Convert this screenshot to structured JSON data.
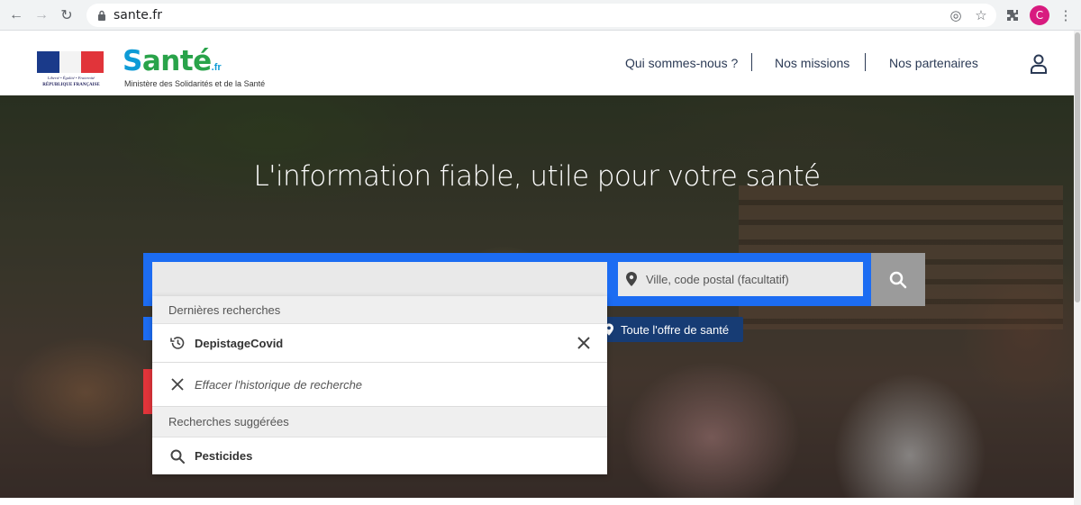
{
  "browser": {
    "url": "sante.fr",
    "profile_initial": "C",
    "icons": [
      "back-arrow-icon",
      "forward-arrow-icon",
      "reload-icon",
      "lock-icon",
      "location-target-icon",
      "star-icon",
      "extensions-icon",
      "menu-dots-icon"
    ]
  },
  "header": {
    "republic_motto": "Liberté • Égalité • Fraternité",
    "republic_name": "RÉPUBLIQUE FRANÇAISE",
    "brand_s": "S",
    "brand_rest": "anté",
    "brand_fr": ".fr",
    "brand_subtitle": "Ministère des Solidarités et de la Santé",
    "nav": [
      "Qui sommes-nous ?",
      "Nos missions",
      "Nos partenaires"
    ]
  },
  "hero": {
    "title": "L'information fiable, utile pour votre santé"
  },
  "search": {
    "query_value": "",
    "location_placeholder": "Ville, code postal (facultatif)"
  },
  "offer_pill": "Toute l'offre de santé",
  "dropdown": {
    "recent_header": "Dernières recherches",
    "recent_items": [
      "DepistageCovid"
    ],
    "clear_history": "Effacer l'historique de recherche",
    "suggested_header": "Recherches suggérées",
    "suggested_items": [
      "Pesticides"
    ]
  },
  "colors": {
    "search_blue": "#1c6cf2",
    "navy": "#173c74",
    "brand_blue": "#0e9bd6",
    "brand_green": "#29a34a",
    "accent_red": "#e1343a"
  }
}
